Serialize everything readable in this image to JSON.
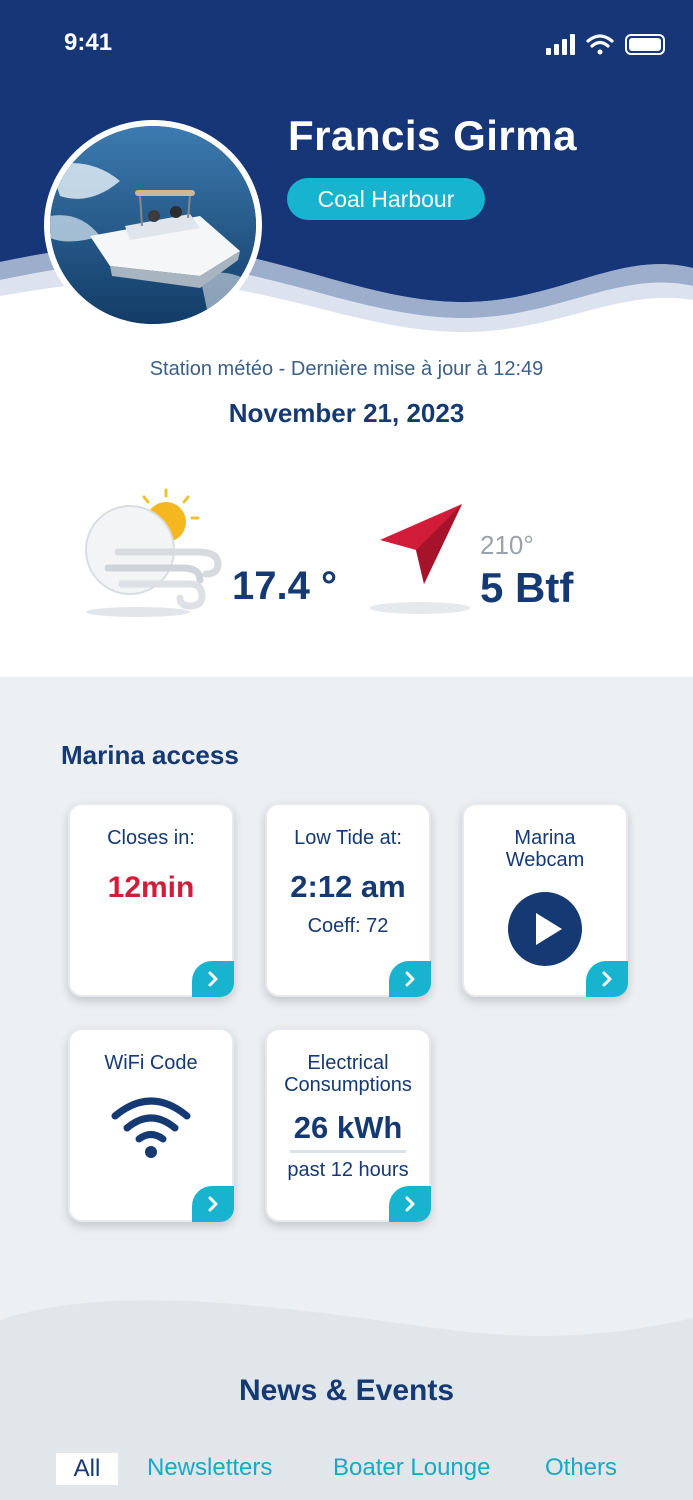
{
  "status_bar": {
    "time": "9:41"
  },
  "profile": {
    "name": "Francis Girma",
    "harbour": "Coal Harbour"
  },
  "weather": {
    "station_label": "Station météo - Dernière mise à jour à 12:49",
    "date": "November 21, 2023",
    "temperature": "17.4 °",
    "wind_direction": "210°",
    "wind_force": "5 Btf"
  },
  "marina": {
    "title": "Marina access",
    "cards": {
      "closes": {
        "title": "Closes in:",
        "value": "12min"
      },
      "tide": {
        "title": "Low Tide at:",
        "value": "2:12 am",
        "sub": "Coeff: 72"
      },
      "webcam": {
        "title_line1": "Marina",
        "title_line2": "Webcam"
      },
      "wifi": {
        "title": "WiFi Code"
      },
      "electric": {
        "title_line1": "Electrical",
        "title_line2": "Consumptions",
        "value": "26 kWh",
        "sub": "past 12 hours"
      }
    }
  },
  "news": {
    "title": "News & Events",
    "filters": [
      "All",
      "Newsletters",
      "Boater Lounge",
      "Others"
    ]
  },
  "colors": {
    "navy": "#153a73",
    "header_bg": "#163677",
    "accent": "#17b3cf",
    "alert": "#d21d3a"
  }
}
